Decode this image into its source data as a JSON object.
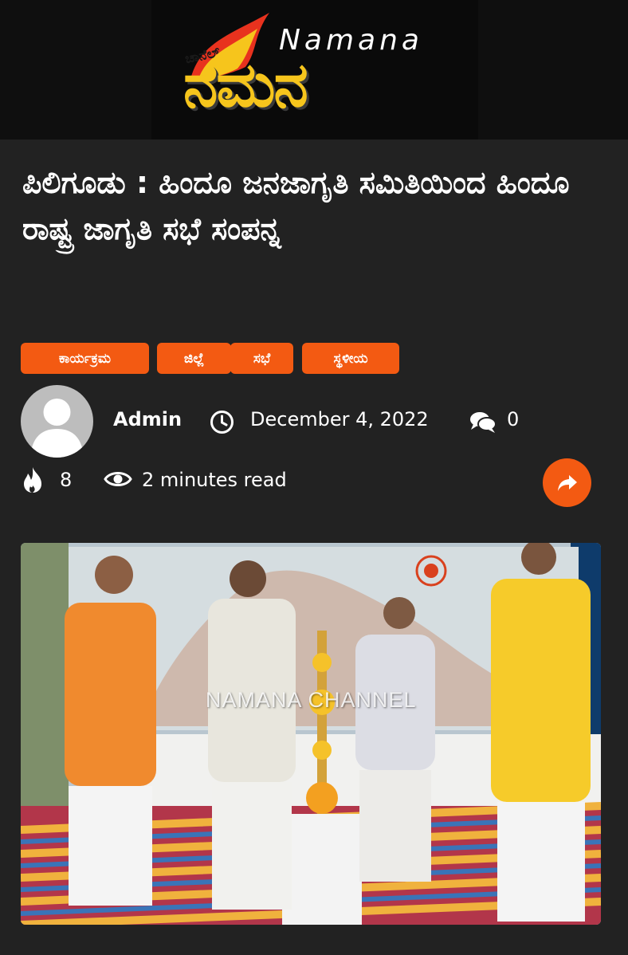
{
  "logo": {
    "latin": "Namana",
    "kannada_small": "ಚಾನೆಲ್",
    "kannada_main": "ನಮನ"
  },
  "article": {
    "title": "ಪಿಲಿಗೂಡು : ಹಿಂದೂ ಜನಜಾಗೃತಿ ಸಮಿತಿಯಿಂದ ಹಿಂದೂ ರಾಷ್ಟ್ರ ಜಾಗೃತಿ ಸಭೆ ಸಂಪನ್ನ",
    "categories": [
      "ಕಾರ್ಯಕ್ರಮ",
      "ಜಿಲ್ಲೆ",
      "ಸಭೆ",
      "ಸ್ಥಳೀಯ"
    ],
    "author": "Admin",
    "date": "December 4, 2022",
    "comments": "0",
    "hot_count": "8",
    "read_time": "2 minutes read",
    "photo_watermark": "NAMANA CHANNEL"
  },
  "icons": {
    "clock": "clock-icon",
    "comments": "comments-icon",
    "fire": "fire-icon",
    "eye": "eye-icon",
    "share": "share-icon"
  },
  "colors": {
    "accent": "#f35a12",
    "logo_yellow": "#f6c51c",
    "background": "#222222"
  }
}
